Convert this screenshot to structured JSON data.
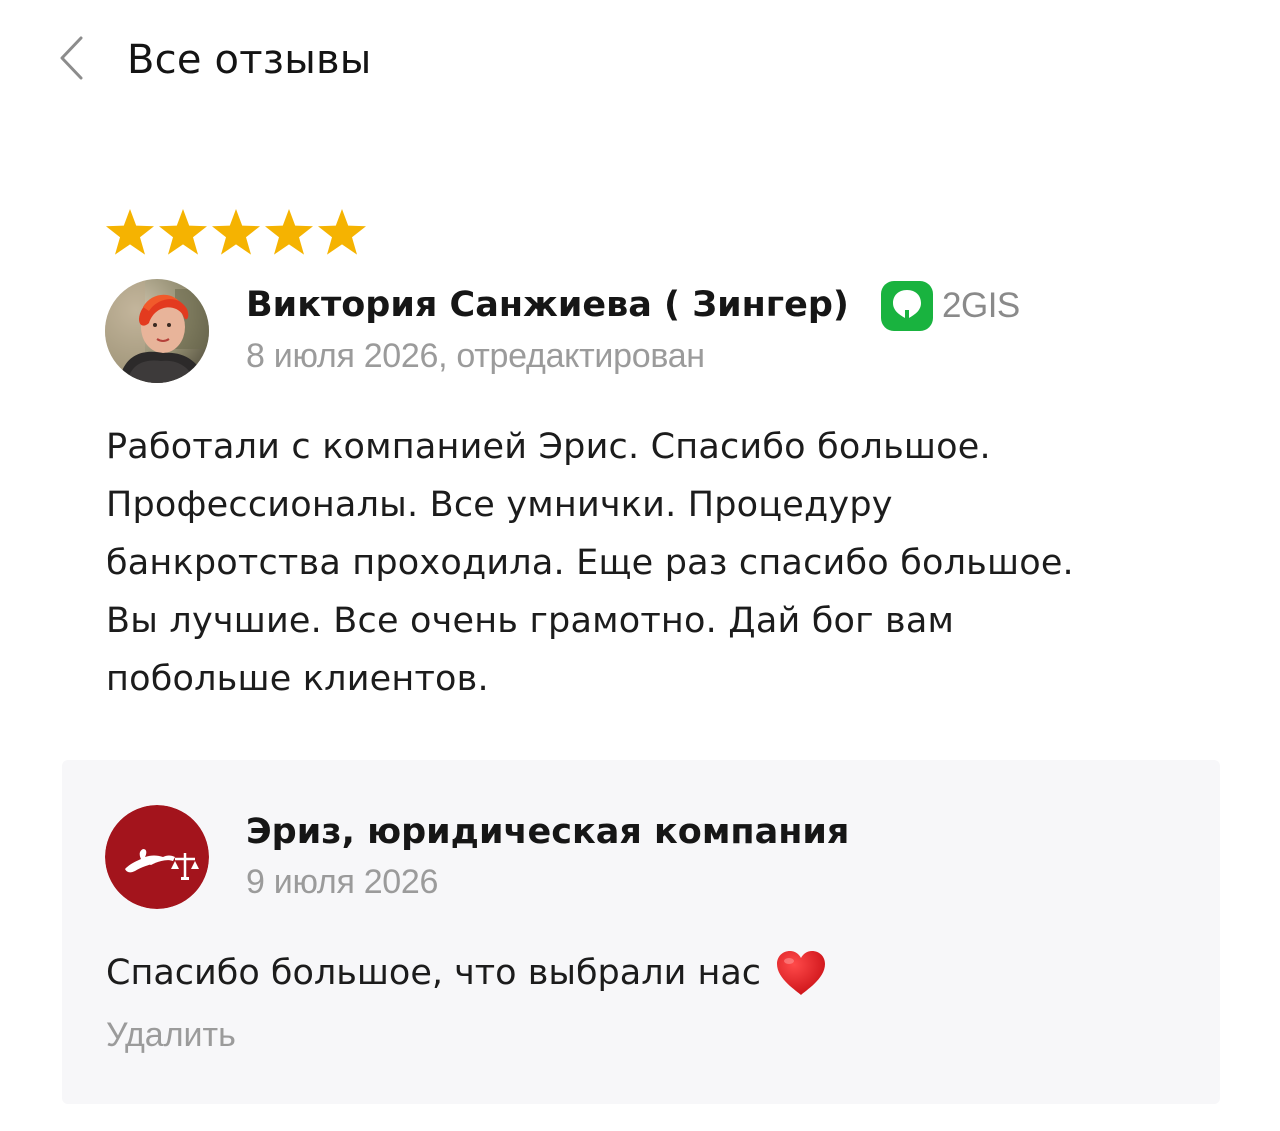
{
  "header": {
    "back_icon": "chevron-left-icon",
    "title": "Все отзывы"
  },
  "review": {
    "rating": 5,
    "rating_max": 5,
    "star_color": "#f5b301",
    "author": {
      "name": "Виктория Санжиева ( Зингер)",
      "avatar": "user-photo"
    },
    "source": {
      "icon": "2gis-logo-icon",
      "label": "2GIS",
      "color": "#19b33f"
    },
    "date": "8 июля 2026, отредактирован",
    "text_lines": [
      "Работали с компанией Эрис. Спасибо большое.",
      "Профессионалы. Все умнички. Процедуру",
      "банкротства проходила. Еще раз спасибо большое.",
      "Вы лучшие. Все очень грамотно. Дай бог вам",
      "побольше клиентов."
    ]
  },
  "reply": {
    "company_name": "Эриз, юридическая компания",
    "avatar": "company-logo",
    "logo_color": "#a3141c",
    "date": "9 июля 2026",
    "text": "Спасибо большое, что выбрали нас",
    "emoji": "heart-icon",
    "delete_label": "Удалить"
  }
}
